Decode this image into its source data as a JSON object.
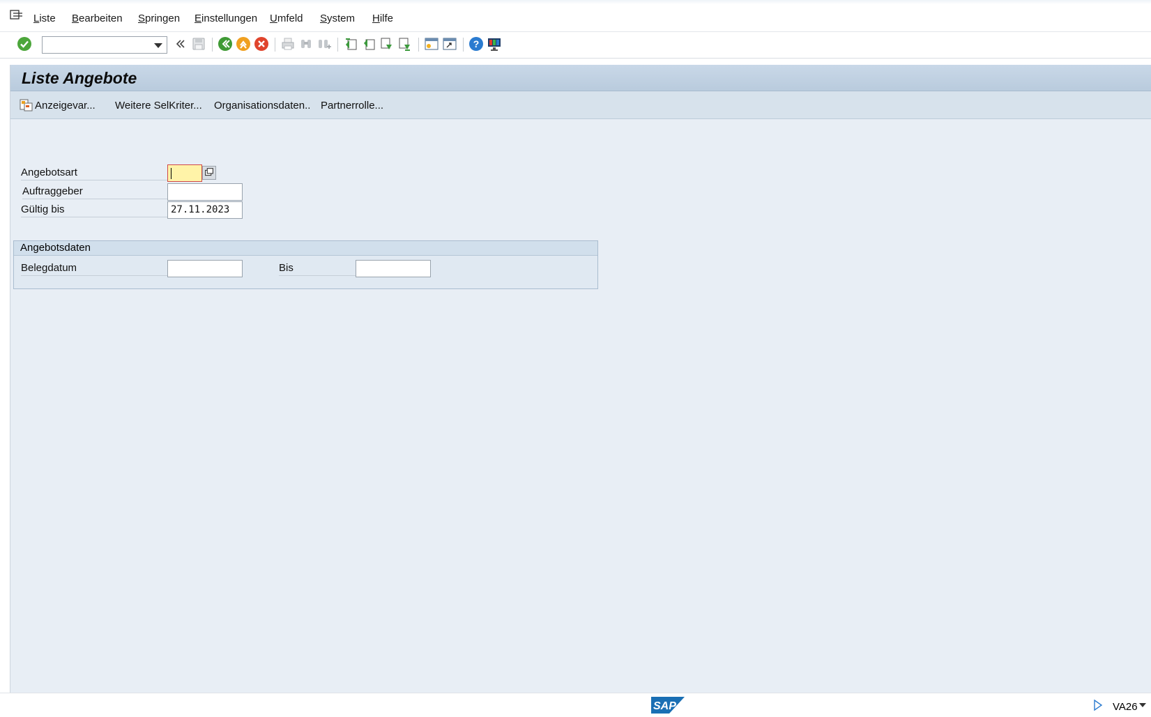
{
  "menubar": {
    "items": [
      {
        "label": "Liste"
      },
      {
        "label": "Bearbeiten"
      },
      {
        "label": "Springen"
      },
      {
        "label": "Einstellungen"
      },
      {
        "label": "Umfeld"
      },
      {
        "label": "System"
      },
      {
        "label": "Hilfe"
      }
    ]
  },
  "toolbar": {
    "command_field": {
      "value": "",
      "placeholder": ""
    },
    "icons": [
      "enter-icon",
      "save-icon",
      "back-icon",
      "exit-icon",
      "cancel-icon",
      "print-icon",
      "find-icon",
      "find-next-icon",
      "first-page-icon",
      "previous-page-icon",
      "next-page-icon",
      "last-page-icon",
      "new-session-icon",
      "create-shortcut-icon",
      "help-icon",
      "customize-layout-icon"
    ]
  },
  "screen": {
    "title": "Liste Angebote"
  },
  "app_toolbar": {
    "buttons": [
      {
        "label": "Anzeigevar..."
      },
      {
        "label": "Weitere SelKriter..."
      },
      {
        "label": "Organisationsdaten.."
      },
      {
        "label": "Partnerrolle..."
      }
    ]
  },
  "form": {
    "angebotsart": {
      "label": "Angebotsart",
      "value": ""
    },
    "auftraggeber": {
      "label": "Auftraggeber",
      "value": ""
    },
    "gueltig_bis": {
      "label": "Gültig bis",
      "value": "27.11.2023"
    }
  },
  "group": {
    "title": "Angebotsdaten",
    "belegdatum": {
      "label": "Belegdatum",
      "value": ""
    },
    "bis": {
      "label": "Bis",
      "value": ""
    }
  },
  "statusbar": {
    "logo_text": "SAP",
    "transaction_code": "VA26"
  },
  "colors": {
    "main_bg": "#e8eef5",
    "title_bar": "#c9d8e8",
    "active_field": "#fff3a8",
    "sap_blue": "#1a6fb4"
  }
}
